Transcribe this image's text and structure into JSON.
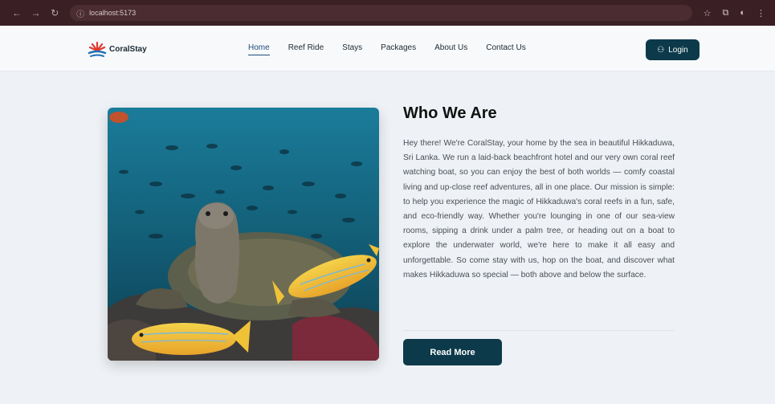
{
  "browser": {
    "url": "localhost:5173"
  },
  "header": {
    "brand": "CoralStay",
    "nav": [
      {
        "label": "Home",
        "active": true
      },
      {
        "label": "Reef Ride",
        "active": false
      },
      {
        "label": "Stays",
        "active": false
      },
      {
        "label": "Packages",
        "active": false
      },
      {
        "label": "About Us",
        "active": false
      },
      {
        "label": "Contact Us",
        "active": false
      }
    ],
    "login_label": "Login"
  },
  "about": {
    "title": "Who We Are",
    "body": "Hey there! We're CoralStay, your home by the sea in beautiful Hikkaduwa, Sri Lanka. We run a laid-back beachfront hotel and our very own coral reef watching boat, so you can enjoy the best of both worlds — comfy coastal living and up-close reef adventures, all in one place. Our mission is simple: to help you experience the magic of Hikkaduwa's coral reefs in a fun, safe, and eco-friendly way. Whether you're lounging in one of our sea-view rooms, sipping a drink under a palm tree, or heading out on a boat to explore the underwater world, we're here to make it all easy and unforgettable. So come stay with us, hop on the boat, and discover what makes Hikkaduwa so special — both above and below the surface.",
    "read_more_label": "Read More"
  },
  "colors": {
    "primary": "#0c3a4a",
    "nav_active": "#1f4c7a",
    "chrome": "#3a1f24"
  }
}
